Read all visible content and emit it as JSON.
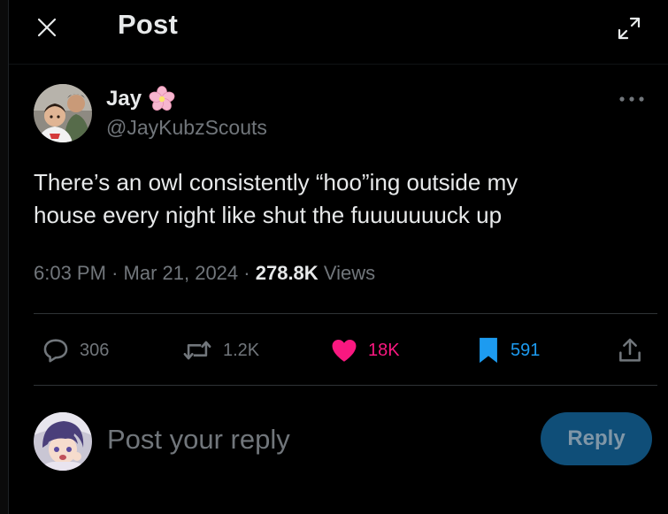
{
  "header": {
    "title": "Post",
    "close_icon": "close-icon",
    "expand_icon": "expand-icon"
  },
  "author": {
    "name": "Jay",
    "name_emoji": "cherry-blossom-icon",
    "handle": "@JayKubzScouts"
  },
  "tweet": {
    "text": "There’s an owl consistently “hoo”ing outside my\nhouse every night like shut the fuuuuuuuck up",
    "time": "6:03 PM",
    "sep1": "·",
    "date": "Mar 21, 2024",
    "sep2": "·",
    "views_count": "278.8K",
    "views_label": "Views"
  },
  "actions": {
    "reply_count": "306",
    "retweet_count": "1.2K",
    "like_count": "18K",
    "bookmark_count": "591"
  },
  "composer": {
    "placeholder": "Post your reply",
    "button_label": "Reply"
  },
  "colors": {
    "background": "#000000",
    "text": "#e7e9ea",
    "muted": "#71767b",
    "like": "#f91880",
    "bookmark": "#1d9bf0",
    "reply_button_bg": "#0f4e78",
    "divider": "#2f3336"
  }
}
